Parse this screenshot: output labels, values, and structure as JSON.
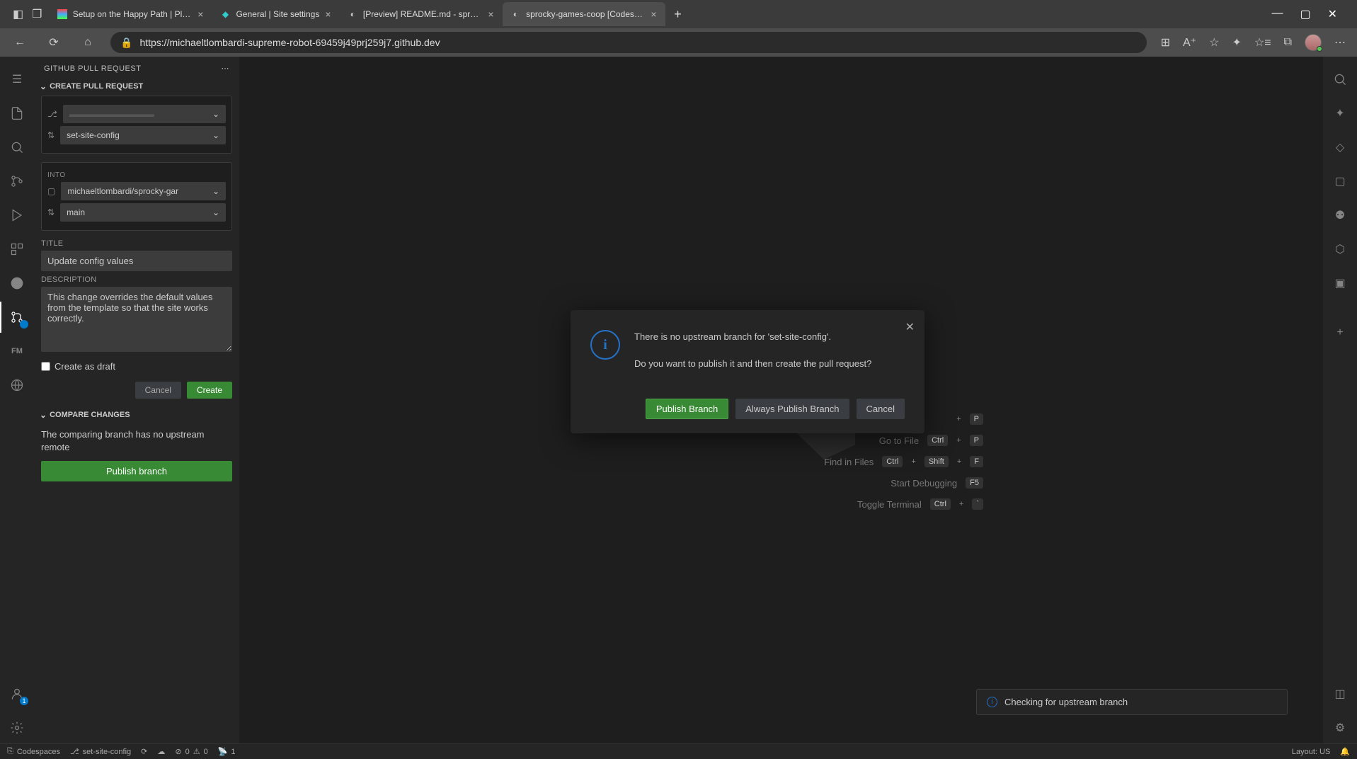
{
  "browser": {
    "tabs": [
      {
        "title": "Setup on the Happy Path | Platen",
        "active": false
      },
      {
        "title": "General | Site settings",
        "active": false
      },
      {
        "title": "[Preview] README.md - sprocky",
        "active": false
      },
      {
        "title": "sprocky-games-coop [Codespac",
        "active": true
      }
    ],
    "url": "https://michaeltlombardi-supreme-robot-69459j49prj259j7.github.dev"
  },
  "sidebar": {
    "header": "GITHUB PULL REQUEST",
    "sections": {
      "create": {
        "title": "CREATE PULL REQUEST",
        "from_branch": "set-site-config",
        "into_label": "INTO",
        "into_repo": "michaeltlombardi/sprocky-gar",
        "into_branch": "main",
        "title_label": "TITLE",
        "title_value": "Update config values",
        "desc_label": "DESCRIPTION",
        "desc_value": "This change overrides the default values from the template so that the site works correctly.",
        "draft_label": "Create as draft",
        "cancel": "Cancel",
        "create_btn": "Create"
      },
      "compare": {
        "title": "COMPARE CHANGES",
        "text": "The comparing branch has no upstream remote",
        "publish_btn": "Publish branch"
      }
    }
  },
  "shortcuts": [
    {
      "label": "",
      "keys": [
        "",
        "+",
        "P"
      ]
    },
    {
      "label": "Go to File",
      "keys": [
        "Ctrl",
        "+",
        "P"
      ]
    },
    {
      "label": "Find in Files",
      "keys": [
        "Ctrl",
        "+",
        "Shift",
        "+",
        "F"
      ]
    },
    {
      "label": "Start Debugging",
      "keys": [
        "F5"
      ]
    },
    {
      "label": "Toggle Terminal",
      "keys": [
        "Ctrl",
        "+",
        "`"
      ]
    }
  ],
  "modal": {
    "line1": "There is no upstream branch for 'set-site-config'.",
    "line2": "Do you want to publish it and then create the pull request?",
    "btn_primary": "Publish Branch",
    "btn_always": "Always Publish Branch",
    "btn_cancel": "Cancel"
  },
  "toast": {
    "text": "Checking for upstream branch"
  },
  "status": {
    "codespaces": "Codespaces",
    "branch": "set-site-config",
    "errors": "0",
    "warnings": "0",
    "ports": "1",
    "layout": "Layout: US"
  }
}
